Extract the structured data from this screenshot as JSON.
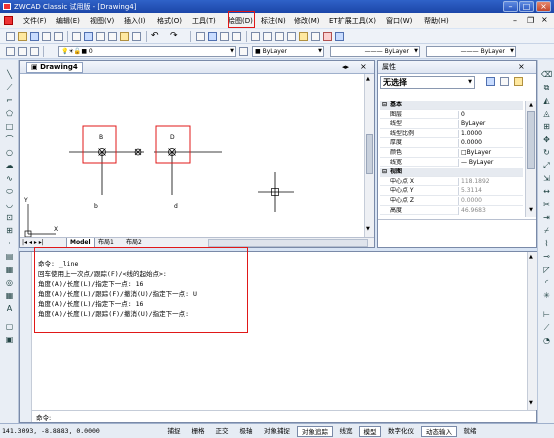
{
  "window": {
    "title": "ZWCAD Classic 试用版 - [Drawing4]"
  },
  "menu": [
    "文件(F)",
    "编辑(E)",
    "视图(V)",
    "插入(I)",
    "格式(O)",
    "工具(T)",
    "绘图(D)",
    "标注(N)",
    "修改(M)",
    "ET扩展工具(X)",
    "窗口(W)",
    "帮助(H)"
  ],
  "layer_toolbar": {
    "layer_value": "0",
    "color_value": "ByLayer",
    "linetype_value": "ByLayer",
    "lineweight_value": "ByLayer"
  },
  "document": {
    "tab": "Drawing4",
    "layout_tabs": [
      "Model",
      "布局1",
      "布局2"
    ],
    "points": [
      {
        "label": "B",
        "boxed": true
      },
      {
        "label": "D",
        "boxed": true
      }
    ],
    "line_labels": [
      "b",
      "d"
    ],
    "ucs_labels": {
      "y": "Y",
      "x": "X"
    }
  },
  "properties": {
    "title": "属性",
    "selection": "无选择",
    "rows": [
      {
        "key": "基本",
        "cat": true,
        "toggle": "⊟"
      },
      {
        "key": "图层",
        "value": "0"
      },
      {
        "key": "线型",
        "value": "ByLayer"
      },
      {
        "key": "线型比例",
        "value": "1.0000"
      },
      {
        "key": "厚度",
        "value": "0.0000"
      },
      {
        "key": "颜色",
        "value": "□ByLayer"
      },
      {
        "key": "线宽",
        "value": "— ByLayer"
      },
      {
        "key": "视图",
        "cat": true,
        "toggle": "⊟"
      },
      {
        "key": "中心点 X",
        "value": "118.1892",
        "dim": true
      },
      {
        "key": "中心点 Y",
        "value": "5.3114",
        "dim": true
      },
      {
        "key": "中心点 Z",
        "value": "0.0000",
        "dim": true
      },
      {
        "key": "高度",
        "value": "46.9683",
        "dim": true
      }
    ]
  },
  "command": {
    "lines": [
      "命令: _line",
      "回车使用上一次点/跟踪(F)/<线的起始点>:",
      "角度(A)/长度(L)/指定下一点: 16",
      "角度(A)/长度(L)/跟踪(F)/撤消(U)/指定下一点: U",
      "角度(A)/长度(L)/指定下一点: 16",
      "角度(A)/长度(L)/跟踪(F)/撤消(U)/指定下一点:"
    ],
    "prompt": "命令:"
  },
  "status": {
    "coords": "141.3093,  -8.8883,  0.0000",
    "buttons": [
      {
        "label": "捕捉",
        "on": false
      },
      {
        "label": "栅格",
        "on": false
      },
      {
        "label": "正交",
        "on": false
      },
      {
        "label": "极轴",
        "on": false
      },
      {
        "label": "对象捕捉",
        "on": false
      },
      {
        "label": "对象追踪",
        "on": true
      },
      {
        "label": "线宽",
        "on": false
      },
      {
        "label": "模型",
        "on": true
      },
      {
        "label": "数字化仪",
        "on": false
      },
      {
        "label": "动态输入",
        "on": true
      },
      {
        "label": "就绪",
        "on": false
      }
    ]
  },
  "colors": {
    "highlight": "#e01818",
    "titlebar": "#1c46a8"
  }
}
